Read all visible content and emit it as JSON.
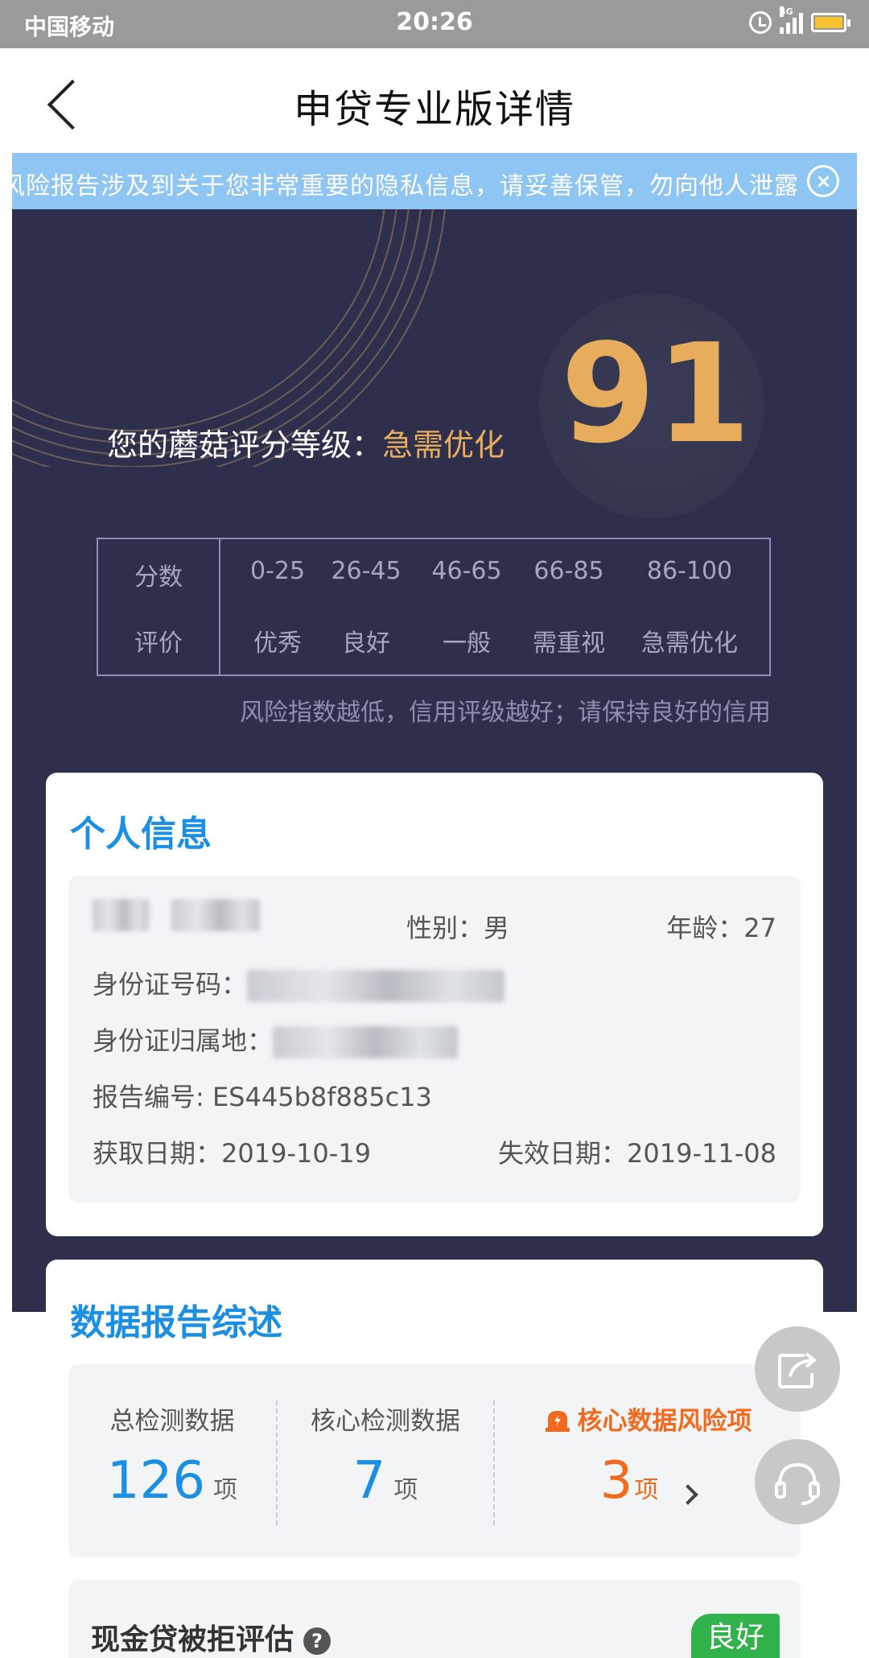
{
  "status_bar": {
    "carrier": "中国移动",
    "time": "20:26",
    "network": "4G"
  },
  "nav": {
    "title": "申贷专业版详情"
  },
  "notice": {
    "text": "风险报告涉及到关于您非常重要的隐私信息，请妥善保管，勿向他人泄露"
  },
  "score": {
    "value": "91",
    "label_prefix": "您的蘑菇评分等级：",
    "grade": "急需优化",
    "accent_color": "#e7ad5c"
  },
  "grade_table": {
    "header_score": "分数",
    "header_rating": "评价",
    "ranges": [
      "0-25",
      "26-45",
      "46-65",
      "66-85",
      "86-100"
    ],
    "ratings": [
      "优秀",
      "良好",
      "一般",
      "需重视",
      "急需优化"
    ],
    "note": "风险指数越低，信用评级越好；请保持良好的信用"
  },
  "personal_info": {
    "title": "个人信息",
    "gender": "性别：男",
    "age": "年龄：27",
    "id_number_label": "身份证号码：",
    "id_location_label": "身份证归属地：",
    "report_no": "报告编号: ES445b8f885c13",
    "acquire_date": "获取日期：2019-10-19",
    "expire_date": "失效日期：2019-11-08"
  },
  "summary": {
    "title": "数据报告综述",
    "total_label": "总检测数据",
    "total_value": "126",
    "core_label": "核心检测数据",
    "core_value": "7",
    "risk_label": "核心数据风险项",
    "risk_value": "3",
    "unit": "项",
    "primary_color": "#1a8fe3",
    "risk_color": "#f26a1e"
  },
  "cash_loan": {
    "title": "现金贷被拒评估",
    "help": "?",
    "status": "良好",
    "status_color": "#32b24b"
  },
  "floating": {
    "share_icon": "share-icon",
    "support_icon": "headset-icon"
  }
}
